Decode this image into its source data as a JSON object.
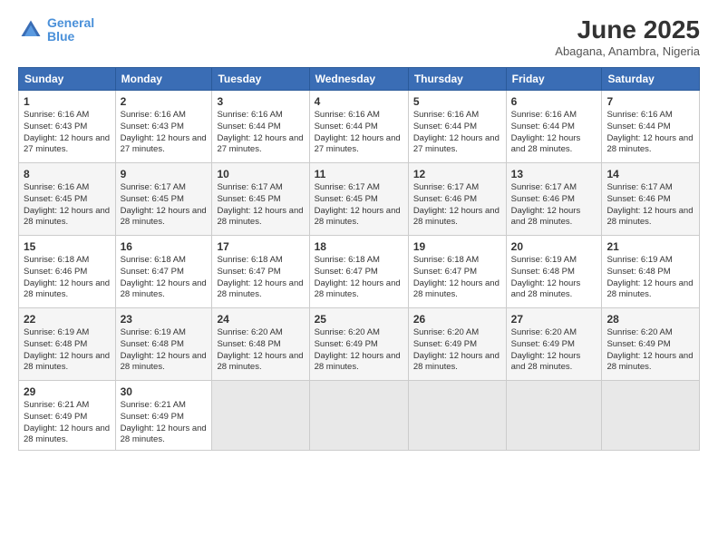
{
  "logo": {
    "line1": "General",
    "line2": "Blue"
  },
  "title": "June 2025",
  "subtitle": "Abagana, Anambra, Nigeria",
  "headers": [
    "Sunday",
    "Monday",
    "Tuesday",
    "Wednesday",
    "Thursday",
    "Friday",
    "Saturday"
  ],
  "weeks": [
    [
      {
        "day": "1",
        "sunrise": "6:16 AM",
        "sunset": "6:43 PM",
        "daylight": "12 hours and 27 minutes."
      },
      {
        "day": "2",
        "sunrise": "6:16 AM",
        "sunset": "6:43 PM",
        "daylight": "12 hours and 27 minutes."
      },
      {
        "day": "3",
        "sunrise": "6:16 AM",
        "sunset": "6:44 PM",
        "daylight": "12 hours and 27 minutes."
      },
      {
        "day": "4",
        "sunrise": "6:16 AM",
        "sunset": "6:44 PM",
        "daylight": "12 hours and 27 minutes."
      },
      {
        "day": "5",
        "sunrise": "6:16 AM",
        "sunset": "6:44 PM",
        "daylight": "12 hours and 27 minutes."
      },
      {
        "day": "6",
        "sunrise": "6:16 AM",
        "sunset": "6:44 PM",
        "daylight": "12 hours and 28 minutes."
      },
      {
        "day": "7",
        "sunrise": "6:16 AM",
        "sunset": "6:44 PM",
        "daylight": "12 hours and 28 minutes."
      }
    ],
    [
      {
        "day": "8",
        "sunrise": "6:16 AM",
        "sunset": "6:45 PM",
        "daylight": "12 hours and 28 minutes."
      },
      {
        "day": "9",
        "sunrise": "6:17 AM",
        "sunset": "6:45 PM",
        "daylight": "12 hours and 28 minutes."
      },
      {
        "day": "10",
        "sunrise": "6:17 AM",
        "sunset": "6:45 PM",
        "daylight": "12 hours and 28 minutes."
      },
      {
        "day": "11",
        "sunrise": "6:17 AM",
        "sunset": "6:45 PM",
        "daylight": "12 hours and 28 minutes."
      },
      {
        "day": "12",
        "sunrise": "6:17 AM",
        "sunset": "6:46 PM",
        "daylight": "12 hours and 28 minutes."
      },
      {
        "day": "13",
        "sunrise": "6:17 AM",
        "sunset": "6:46 PM",
        "daylight": "12 hours and 28 minutes."
      },
      {
        "day": "14",
        "sunrise": "6:17 AM",
        "sunset": "6:46 PM",
        "daylight": "12 hours and 28 minutes."
      }
    ],
    [
      {
        "day": "15",
        "sunrise": "6:18 AM",
        "sunset": "6:46 PM",
        "daylight": "12 hours and 28 minutes."
      },
      {
        "day": "16",
        "sunrise": "6:18 AM",
        "sunset": "6:47 PM",
        "daylight": "12 hours and 28 minutes."
      },
      {
        "day": "17",
        "sunrise": "6:18 AM",
        "sunset": "6:47 PM",
        "daylight": "12 hours and 28 minutes."
      },
      {
        "day": "18",
        "sunrise": "6:18 AM",
        "sunset": "6:47 PM",
        "daylight": "12 hours and 28 minutes."
      },
      {
        "day": "19",
        "sunrise": "6:18 AM",
        "sunset": "6:47 PM",
        "daylight": "12 hours and 28 minutes."
      },
      {
        "day": "20",
        "sunrise": "6:19 AM",
        "sunset": "6:48 PM",
        "daylight": "12 hours and 28 minutes."
      },
      {
        "day": "21",
        "sunrise": "6:19 AM",
        "sunset": "6:48 PM",
        "daylight": "12 hours and 28 minutes."
      }
    ],
    [
      {
        "day": "22",
        "sunrise": "6:19 AM",
        "sunset": "6:48 PM",
        "daylight": "12 hours and 28 minutes."
      },
      {
        "day": "23",
        "sunrise": "6:19 AM",
        "sunset": "6:48 PM",
        "daylight": "12 hours and 28 minutes."
      },
      {
        "day": "24",
        "sunrise": "6:20 AM",
        "sunset": "6:48 PM",
        "daylight": "12 hours and 28 minutes."
      },
      {
        "day": "25",
        "sunrise": "6:20 AM",
        "sunset": "6:49 PM",
        "daylight": "12 hours and 28 minutes."
      },
      {
        "day": "26",
        "sunrise": "6:20 AM",
        "sunset": "6:49 PM",
        "daylight": "12 hours and 28 minutes."
      },
      {
        "day": "27",
        "sunrise": "6:20 AM",
        "sunset": "6:49 PM",
        "daylight": "12 hours and 28 minutes."
      },
      {
        "day": "28",
        "sunrise": "6:20 AM",
        "sunset": "6:49 PM",
        "daylight": "12 hours and 28 minutes."
      }
    ],
    [
      {
        "day": "29",
        "sunrise": "6:21 AM",
        "sunset": "6:49 PM",
        "daylight": "12 hours and 28 minutes."
      },
      {
        "day": "30",
        "sunrise": "6:21 AM",
        "sunset": "6:49 PM",
        "daylight": "12 hours and 28 minutes."
      },
      null,
      null,
      null,
      null,
      null
    ]
  ]
}
